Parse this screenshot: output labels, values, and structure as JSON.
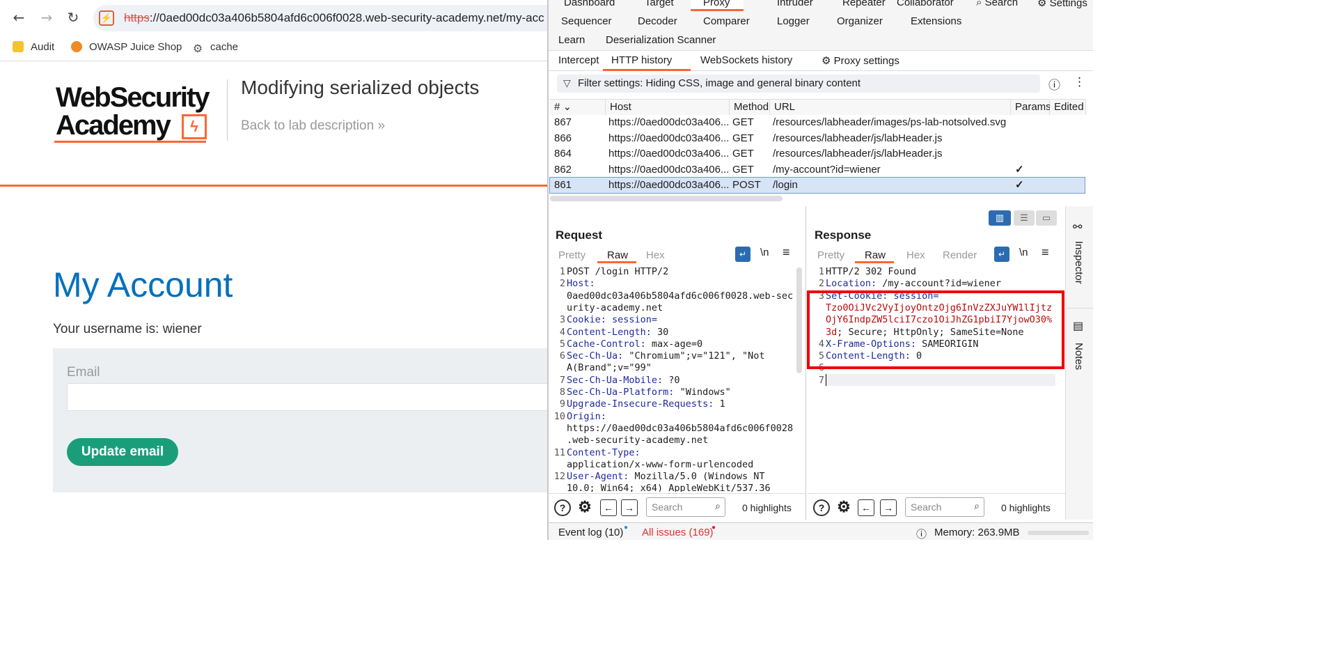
{
  "browser": {
    "url_scheme": "https",
    "url_rest": "://0aed00dc03a406b5804afd6c006f0028.web-security-academy.net/my-acc",
    "bookmarks": [
      "Audit",
      "OWASP Juice Shop",
      "cache"
    ]
  },
  "site": {
    "logo_line1": "WebSecurity",
    "logo_line2": "Academy",
    "lab_title": "Modifying serialized objects",
    "back_link": "Back to lab description",
    "back_chevron": "»",
    "heading": "My Account",
    "username_text": "Your username is: wiener",
    "email_label": "Email",
    "update_button": "Update email"
  },
  "burp": {
    "main_tabs_row1": [
      "Dashboard",
      "Target",
      "Proxy",
      "Intruder",
      "Repeater",
      "Collaborator",
      "Search",
      "Settings"
    ],
    "main_tabs_row2": [
      "Sequencer",
      "Decoder",
      "Comparer",
      "Logger",
      "Organizer",
      "Extensions"
    ],
    "main_tabs_row3": [
      "Learn",
      "Deserialization Scanner"
    ],
    "sub_tabs": [
      "Intercept",
      "HTTP history",
      "WebSockets history",
      "Proxy settings"
    ],
    "filter_text": "Filter settings: Hiding CSS, image and general binary content",
    "columns": [
      "#",
      "Host",
      "Method",
      "URL",
      "Params",
      "Edited"
    ],
    "rows": [
      {
        "num": "867",
        "host": "https://0aed00dc03a406...",
        "method": "GET",
        "url": "/resources/labheader/images/ps-lab-notsolved.svg",
        "params": ""
      },
      {
        "num": "866",
        "host": "https://0aed00dc03a406...",
        "method": "GET",
        "url": "/resources/labheader/js/labHeader.js",
        "params": ""
      },
      {
        "num": "864",
        "host": "https://0aed00dc03a406...",
        "method": "GET",
        "url": "/resources/labheader/js/labHeader.js",
        "params": ""
      },
      {
        "num": "862",
        "host": "https://0aed00dc03a406...",
        "method": "GET",
        "url": "/my-account?id=wiener",
        "params": "✓"
      },
      {
        "num": "861",
        "host": "https://0aed00dc03a406...",
        "method": "POST",
        "url": "/login",
        "params": "✓"
      }
    ],
    "request": {
      "title": "Request",
      "tabs": [
        "Pretty",
        "Raw",
        "Hex"
      ],
      "newline_label": "\\n",
      "lines": [
        {
          "n": "1",
          "k": "",
          "v": "POST /login HTTP/2"
        },
        {
          "n": "2",
          "k": "Host:",
          "v": ""
        },
        {
          "n": "",
          "k": "",
          "v": "0aed00dc03a406b5804afd6c006f0028.web-sec"
        },
        {
          "n": "",
          "k": "",
          "v": "urity-academy.net"
        },
        {
          "n": "3",
          "k": "Cookie: session=",
          "v": ""
        },
        {
          "n": "4",
          "k": "Content-Length:",
          "v": " 30"
        },
        {
          "n": "5",
          "k": "Cache-Control:",
          "v": " max-age=0"
        },
        {
          "n": "6",
          "k": "Sec-Ch-Ua:",
          "v": " \"Chromium\";v=\"121\", \"Not"
        },
        {
          "n": "",
          "k": "",
          "v": "A(Brand\";v=\"99\""
        },
        {
          "n": "7",
          "k": "Sec-Ch-Ua-Mobile:",
          "v": " ?0"
        },
        {
          "n": "8",
          "k": "Sec-Ch-Ua-Platform:",
          "v": " \"Windows\""
        },
        {
          "n": "9",
          "k": "Upgrade-Insecure-Requests:",
          "v": " 1"
        },
        {
          "n": "10",
          "k": "Origin:",
          "v": ""
        },
        {
          "n": "",
          "k": "",
          "v": "https://0aed00dc03a406b5804afd6c006f0028"
        },
        {
          "n": "",
          "k": "",
          "v": ".web-security-academy.net"
        },
        {
          "n": "11",
          "k": "Content-Type:",
          "v": ""
        },
        {
          "n": "",
          "k": "",
          "v": "application/x-www-form-urlencoded"
        },
        {
          "n": "12",
          "k": "User-Agent:",
          "v": " Mozilla/5.0 (Windows NT"
        },
        {
          "n": "",
          "k": "",
          "v": "10.0; Win64; x64) AppleWebKit/537.36"
        }
      ],
      "search_placeholder": "Search",
      "highlights": "0 highlights"
    },
    "response": {
      "title": "Response",
      "tabs": [
        "Pretty",
        "Raw",
        "Hex",
        "Render"
      ],
      "newline_label": "\\n",
      "lines": [
        {
          "n": "1",
          "k": "",
          "v": "HTTP/2 302 Found",
          "r": ""
        },
        {
          "n": "2",
          "k": "Location:",
          "v": " /my-account?id=wiener",
          "r": ""
        },
        {
          "n": "3",
          "k": "Set-Cookie: session=",
          "v": "",
          "r": ""
        },
        {
          "n": "",
          "k": "",
          "v": "",
          "r": "Tzo0OiJVc2VyIjoyOntzOjg6InVzZXJuYW1lIjtz"
        },
        {
          "n": "",
          "k": "",
          "v": "",
          "r": "OjY6IndpZW5lciI7czo1OiJhZG1pbiI7YjowO30%"
        },
        {
          "n": "",
          "k": "",
          "v": "; Secure; HttpOnly; SameSite=None",
          "r": "3d"
        },
        {
          "n": "4",
          "k": "X-Frame-Options:",
          "v": " SAMEORIGIN",
          "r": ""
        },
        {
          "n": "5",
          "k": "Content-Length:",
          "v": " 0",
          "r": ""
        },
        {
          "n": "6",
          "k": "",
          "v": "",
          "r": ""
        },
        {
          "n": "7",
          "k": "",
          "v": "",
          "r": ""
        }
      ],
      "search_placeholder": "Search",
      "highlights": "0 highlights"
    },
    "side_rail": [
      "Inspector",
      "Notes"
    ],
    "status": {
      "event_log": "Event log (10)",
      "all_issues": "All issues (169)",
      "memory": "Memory: 263.9MB"
    }
  }
}
